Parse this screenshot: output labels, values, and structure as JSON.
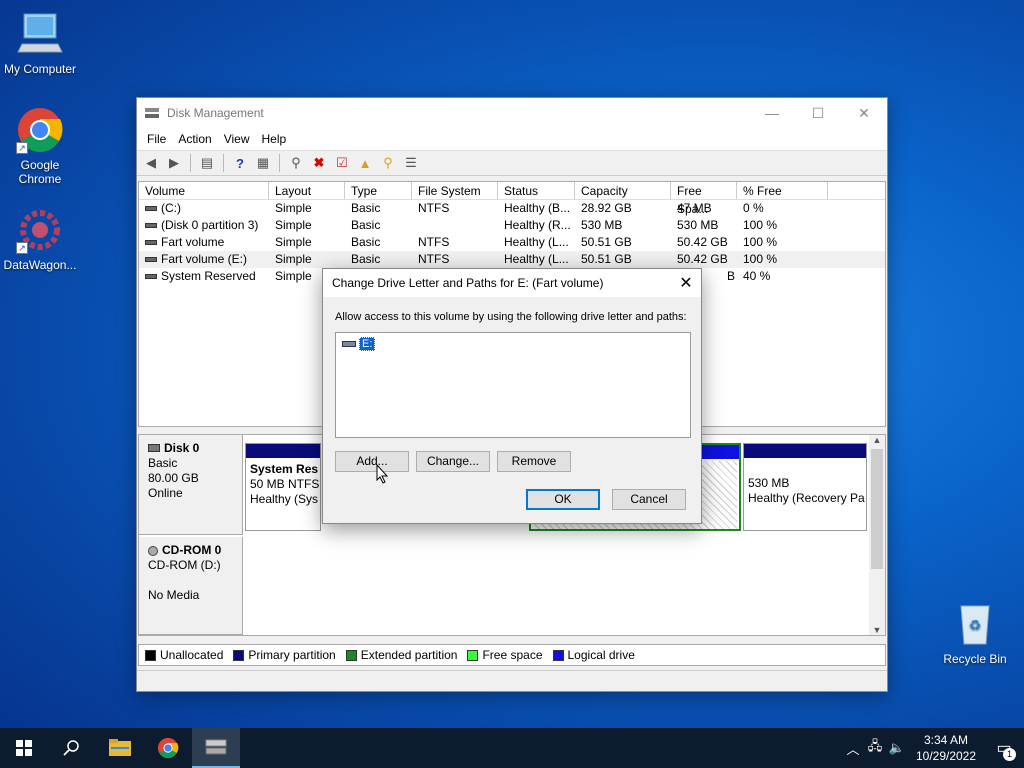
{
  "desktop": {
    "icons": [
      {
        "label": "My Computer"
      },
      {
        "label": "Google Chrome"
      },
      {
        "label": "DataWagon..."
      },
      {
        "label": "Recycle Bin"
      }
    ]
  },
  "window": {
    "title": "Disk Management",
    "menu": [
      "File",
      "Action",
      "View",
      "Help"
    ],
    "columns": [
      "Volume",
      "Layout",
      "Type",
      "File System",
      "Status",
      "Capacity",
      "Free Spa...",
      "% Free"
    ],
    "rows": [
      [
        "(C:)",
        "Simple",
        "Basic",
        "NTFS",
        "Healthy (B...",
        "28.92 GB",
        "47 MB",
        "0 %"
      ],
      [
        "(Disk 0 partition 3)",
        "Simple",
        "Basic",
        "",
        "Healthy (R...",
        "530 MB",
        "530 MB",
        "100 %"
      ],
      [
        "Fart volume",
        "Simple",
        "Basic",
        "NTFS",
        "Healthy (L...",
        "50.51 GB",
        "50.42 GB",
        "100 %"
      ],
      [
        "Fart volume (E:)",
        "Simple",
        "Basic",
        "NTFS",
        "Healthy (L...",
        "50.51 GB",
        "50.42 GB",
        "100 %"
      ],
      [
        "System Reserved",
        "Simple",
        "",
        "",
        "",
        "",
        "B",
        "40 %"
      ]
    ],
    "disks": [
      {
        "name": "Disk 0",
        "lines": [
          "Basic",
          "80.00 GB",
          "Online"
        ]
      },
      {
        "name": "CD-ROM 0",
        "lines": [
          "CD-ROM (D:)",
          "",
          "No Media"
        ]
      }
    ],
    "partitions": {
      "system_reserved": {
        "name": "System Res",
        "size": "50 MB NTFS",
        "status": "Healthy (Sys"
      },
      "recovery": {
        "size": "530 MB",
        "status": "Healthy (Recovery Pa"
      }
    },
    "legend": [
      {
        "label": "Unallocated",
        "color": "#000000"
      },
      {
        "label": "Primary partition",
        "color": "#0a0a7a"
      },
      {
        "label": "Extended partition",
        "color": "#1a8a1a"
      },
      {
        "label": "Free space",
        "color": "#33ff33"
      },
      {
        "label": "Logical drive",
        "color": "#1010e0"
      }
    ]
  },
  "dialog": {
    "title": "Change Drive Letter and Paths for E: (Fart volume)",
    "prompt": "Allow access to this volume by using the following drive letter and paths:",
    "entry": "E:",
    "buttons": {
      "add": "Add...",
      "change": "Change...",
      "remove": "Remove",
      "ok": "OK",
      "cancel": "Cancel"
    }
  },
  "taskbar": {
    "time": "3:34 AM",
    "date": "10/29/2022",
    "notification_count": "1"
  }
}
